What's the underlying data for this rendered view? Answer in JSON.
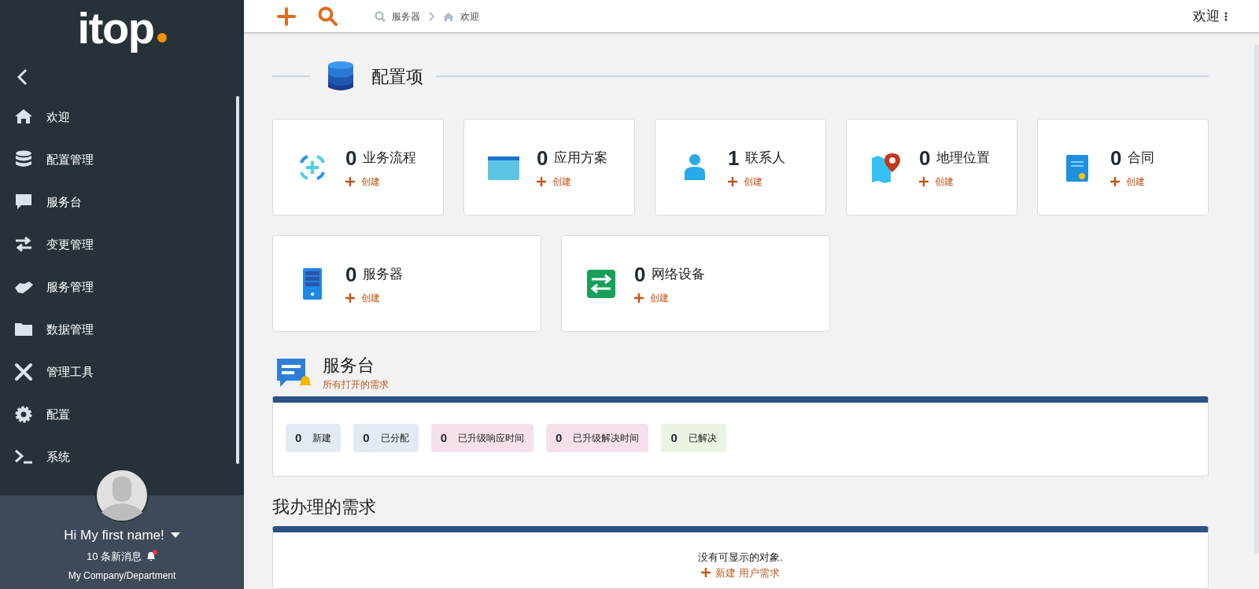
{
  "sidebar": {
    "logo": "itop",
    "menu": [
      {
        "label": "欢迎"
      },
      {
        "label": "配置管理"
      },
      {
        "label": "服务台"
      },
      {
        "label": "变更管理"
      },
      {
        "label": "服务管理"
      },
      {
        "label": "数据管理"
      },
      {
        "label": "管理工具"
      },
      {
        "label": "配置"
      },
      {
        "label": "系统"
      }
    ],
    "user": {
      "greeting": "Hi My first name!",
      "notifications": "10 条新消息",
      "unread": true,
      "organization": "My Company/Department"
    }
  },
  "header": {
    "breadcrumbs": [
      {
        "label": "服务器"
      },
      {
        "label": "欢迎"
      }
    ],
    "user_menu": "欢迎"
  },
  "ci_section": {
    "title": "配置项",
    "cards": [
      {
        "count": "0",
        "label": "业务流程",
        "action": "创建"
      },
      {
        "count": "0",
        "label": "应用方案",
        "action": "创建"
      },
      {
        "count": "1",
        "label": "联系人",
        "action": "创建"
      },
      {
        "count": "0",
        "label": "地理位置",
        "action": "创建"
      },
      {
        "count": "0",
        "label": "合同",
        "action": "创建"
      },
      {
        "count": "0",
        "label": "服务器",
        "action": "创建"
      },
      {
        "count": "0",
        "label": "网络设备",
        "action": "创建"
      }
    ]
  },
  "helpdesk": {
    "title": "服务台",
    "subtitle": "所有打开的需求",
    "badges": [
      {
        "count": "0",
        "label": "新建",
        "color": "#e3eaf4"
      },
      {
        "count": "0",
        "label": "已分配",
        "color": "#e3eaf4"
      },
      {
        "count": "0",
        "label": "已升级响应时间",
        "color": "#f6e0ec"
      },
      {
        "count": "0",
        "label": "已升级解决时间",
        "color": "#f6e0ec"
      },
      {
        "count": "0",
        "label": "已解决",
        "color": "#ebf3e3"
      }
    ]
  },
  "my_requests": {
    "title": "我办理的需求",
    "empty_message": "没有可显示的对象.",
    "action": "新建 用户需求"
  }
}
